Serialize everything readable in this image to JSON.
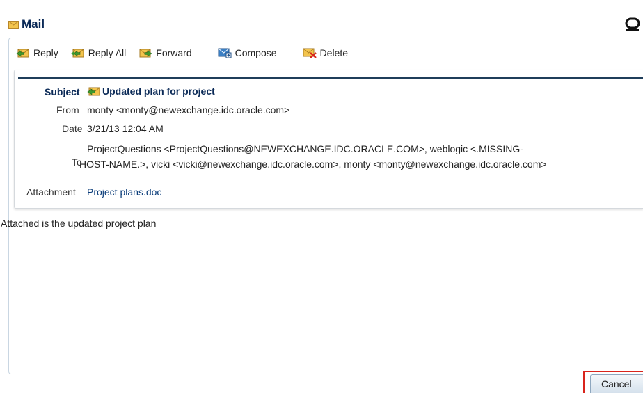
{
  "window": {
    "title": "Mail"
  },
  "toolbar": {
    "reply_label": "Reply",
    "reply_all_label": "Reply All",
    "forward_label": "Forward",
    "compose_label": "Compose",
    "delete_label": "Delete"
  },
  "message": {
    "labels": {
      "subject": "Subject",
      "from": "From",
      "date": "Date",
      "to": "To",
      "attachment": "Attachment"
    },
    "subject": "Updated plan for project",
    "from": "monty <monty@newexchange.idc.oracle.com>",
    "date": "3/21/13 12:04 AM",
    "to_line1": "ProjectQuestions <ProjectQuestions@NEWEXCHANGE.IDC.ORACLE.COM>, weblogic <.MISSING-",
    "to_line2": "HOST-NAME.>, vicki <vicki@newexchange.idc.oracle.com>, monty <monty@newexchange.idc.oracle.com>",
    "attachment": "Project plans.doc",
    "body": "Attached is the updated project plan"
  },
  "footer": {
    "cancel_label": "Cancel"
  },
  "icons": [
    "mail-icon",
    "oracle-logo-icon",
    "reply-icon",
    "reply-all-icon",
    "forward-icon",
    "compose-icon",
    "delete-icon",
    "replied-status-icon"
  ],
  "colors": {
    "title": "#0b2a57",
    "header_rule": "#1f3e5a",
    "link": "#0b3d7a",
    "highlight_outline": "#d9241c"
  }
}
